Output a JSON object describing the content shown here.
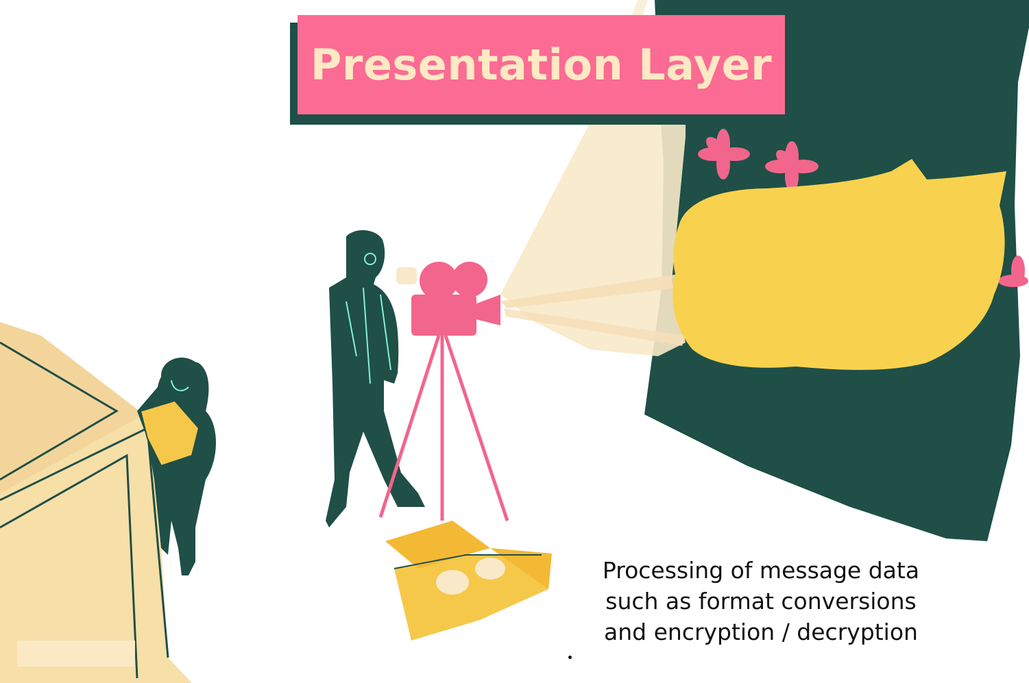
{
  "title": "Presentation Layer",
  "caption": {
    "line1": "Processing of message data",
    "line2": "such as format conversions",
    "line3": "and encryption / decryption"
  },
  "colors": {
    "banner": "#fb6b93",
    "banner_shadow": "#1f4f47",
    "title_text": "#fde9c4",
    "screen": "#1f4f47",
    "cat": "#f8d24e",
    "beam": "#f8e9c9",
    "camera": "#f2658d",
    "box": "#f6c84a",
    "crate": "#f7dfa8",
    "figure": "#1f4f47",
    "outline": "#83f2d6"
  },
  "icons": {
    "projector": "camera-on-tripod",
    "projected_image": "cat-silhouette",
    "flowers": "pink-flower",
    "package": "cardboard-box"
  }
}
